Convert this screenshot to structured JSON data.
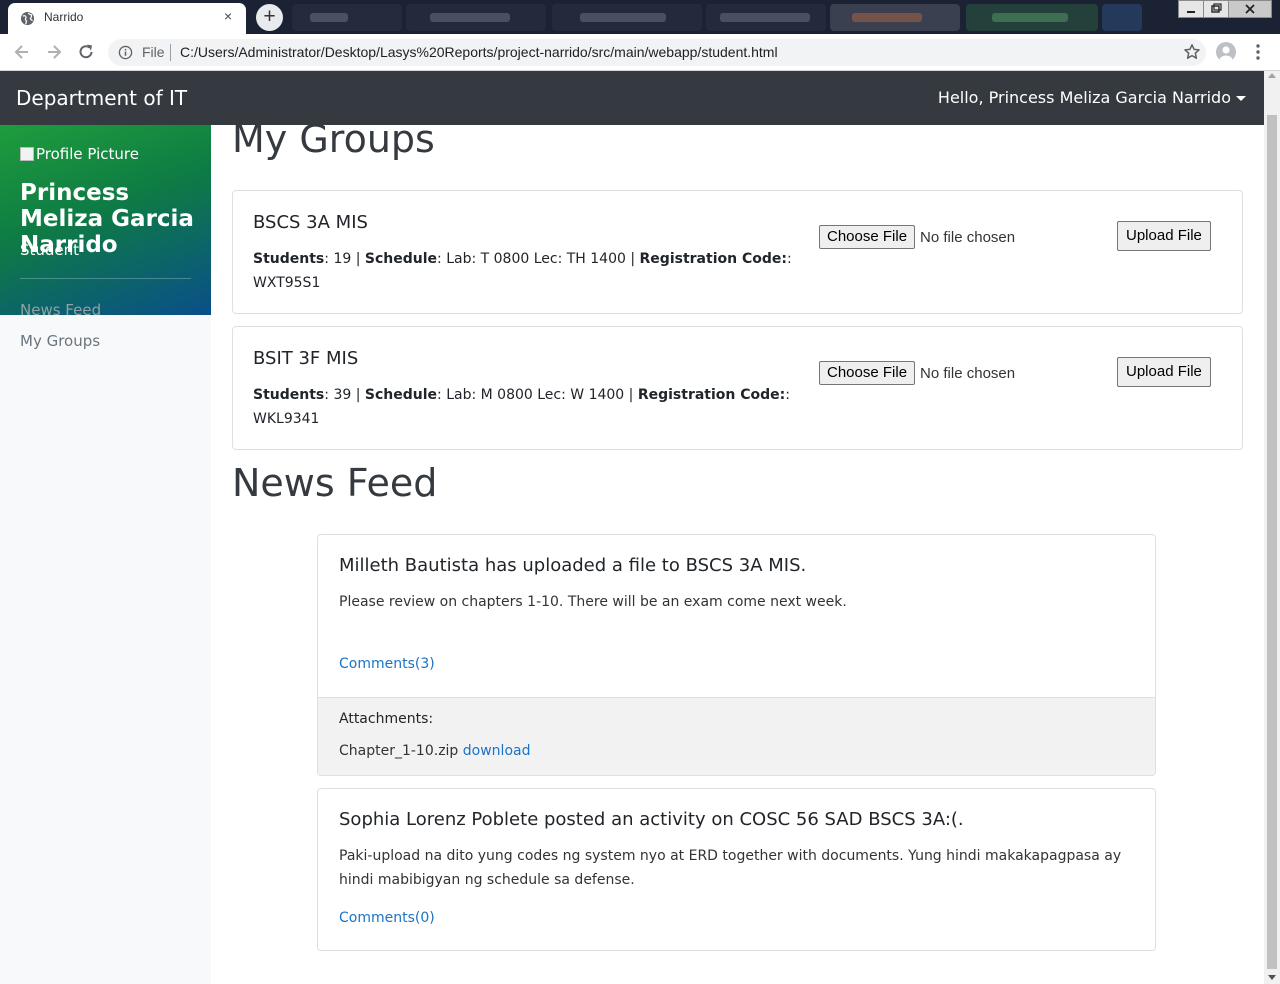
{
  "browser": {
    "tab_title": "Narrido",
    "tab_close": "×",
    "new_tab": "+",
    "address_scheme": "File",
    "address_url": "C:/Users/Administrator/Desktop/Lasys%20Reports/project-narrido/src/main/webapp/student.html"
  },
  "navbar": {
    "brand": "Department of IT",
    "user_greeting": "Hello, Princess Meliza Garcia Narrido"
  },
  "sidebar": {
    "profile_picture_alt": "Profile Picture",
    "name": "Princess Meliza Garcia Narrido",
    "role": "Student",
    "nav": [
      {
        "label": "News Feed"
      },
      {
        "label": "My Groups"
      }
    ]
  },
  "my_groups": {
    "heading": "My Groups",
    "choose_file_label": "Choose File",
    "no_file_label": "No file chosen",
    "upload_label": "Upload File",
    "students_label": "Students",
    "schedule_label": "Schedule",
    "regcode_label": "Registration Code:",
    "groups": [
      {
        "name": "BSCS 3A MIS",
        "students": "19",
        "schedule": "Lab: T 0800 Lec: TH 1400",
        "code": "WXT95S1"
      },
      {
        "name": "BSIT 3F MIS",
        "students": "39",
        "schedule": "Lab: M 0800 Lec: W 1400",
        "code": "WKL9341"
      }
    ]
  },
  "news_feed": {
    "heading": "News Feed",
    "posts": [
      {
        "title": "Milleth Bautista has uploaded a file to BSCS 3A MIS.",
        "body": "Please review on chapters 1-10. There will be an exam come next week.",
        "comments": "Comments(3)",
        "attachments_label": "Attachments:",
        "attachment_name": "Chapter_1-10.zip",
        "download_label": "download"
      },
      {
        "title": "Sophia Lorenz Poblete posted an activity on COSC 56 SAD BSCS 3A:(.",
        "body": "Paki-upload na dito yung codes ng system nyo at ERD together with documents. Yung hindi makakapagpasa ay hindi mabibigyan ng schedule sa defense.",
        "comments": "Comments(0)"
      }
    ]
  },
  "colors": {
    "navbar_bg": "#343a40",
    "link": "#1a73c7",
    "sidebar_gradient_start": "#1f9d3d",
    "sidebar_gradient_end": "#0a4f8a"
  }
}
